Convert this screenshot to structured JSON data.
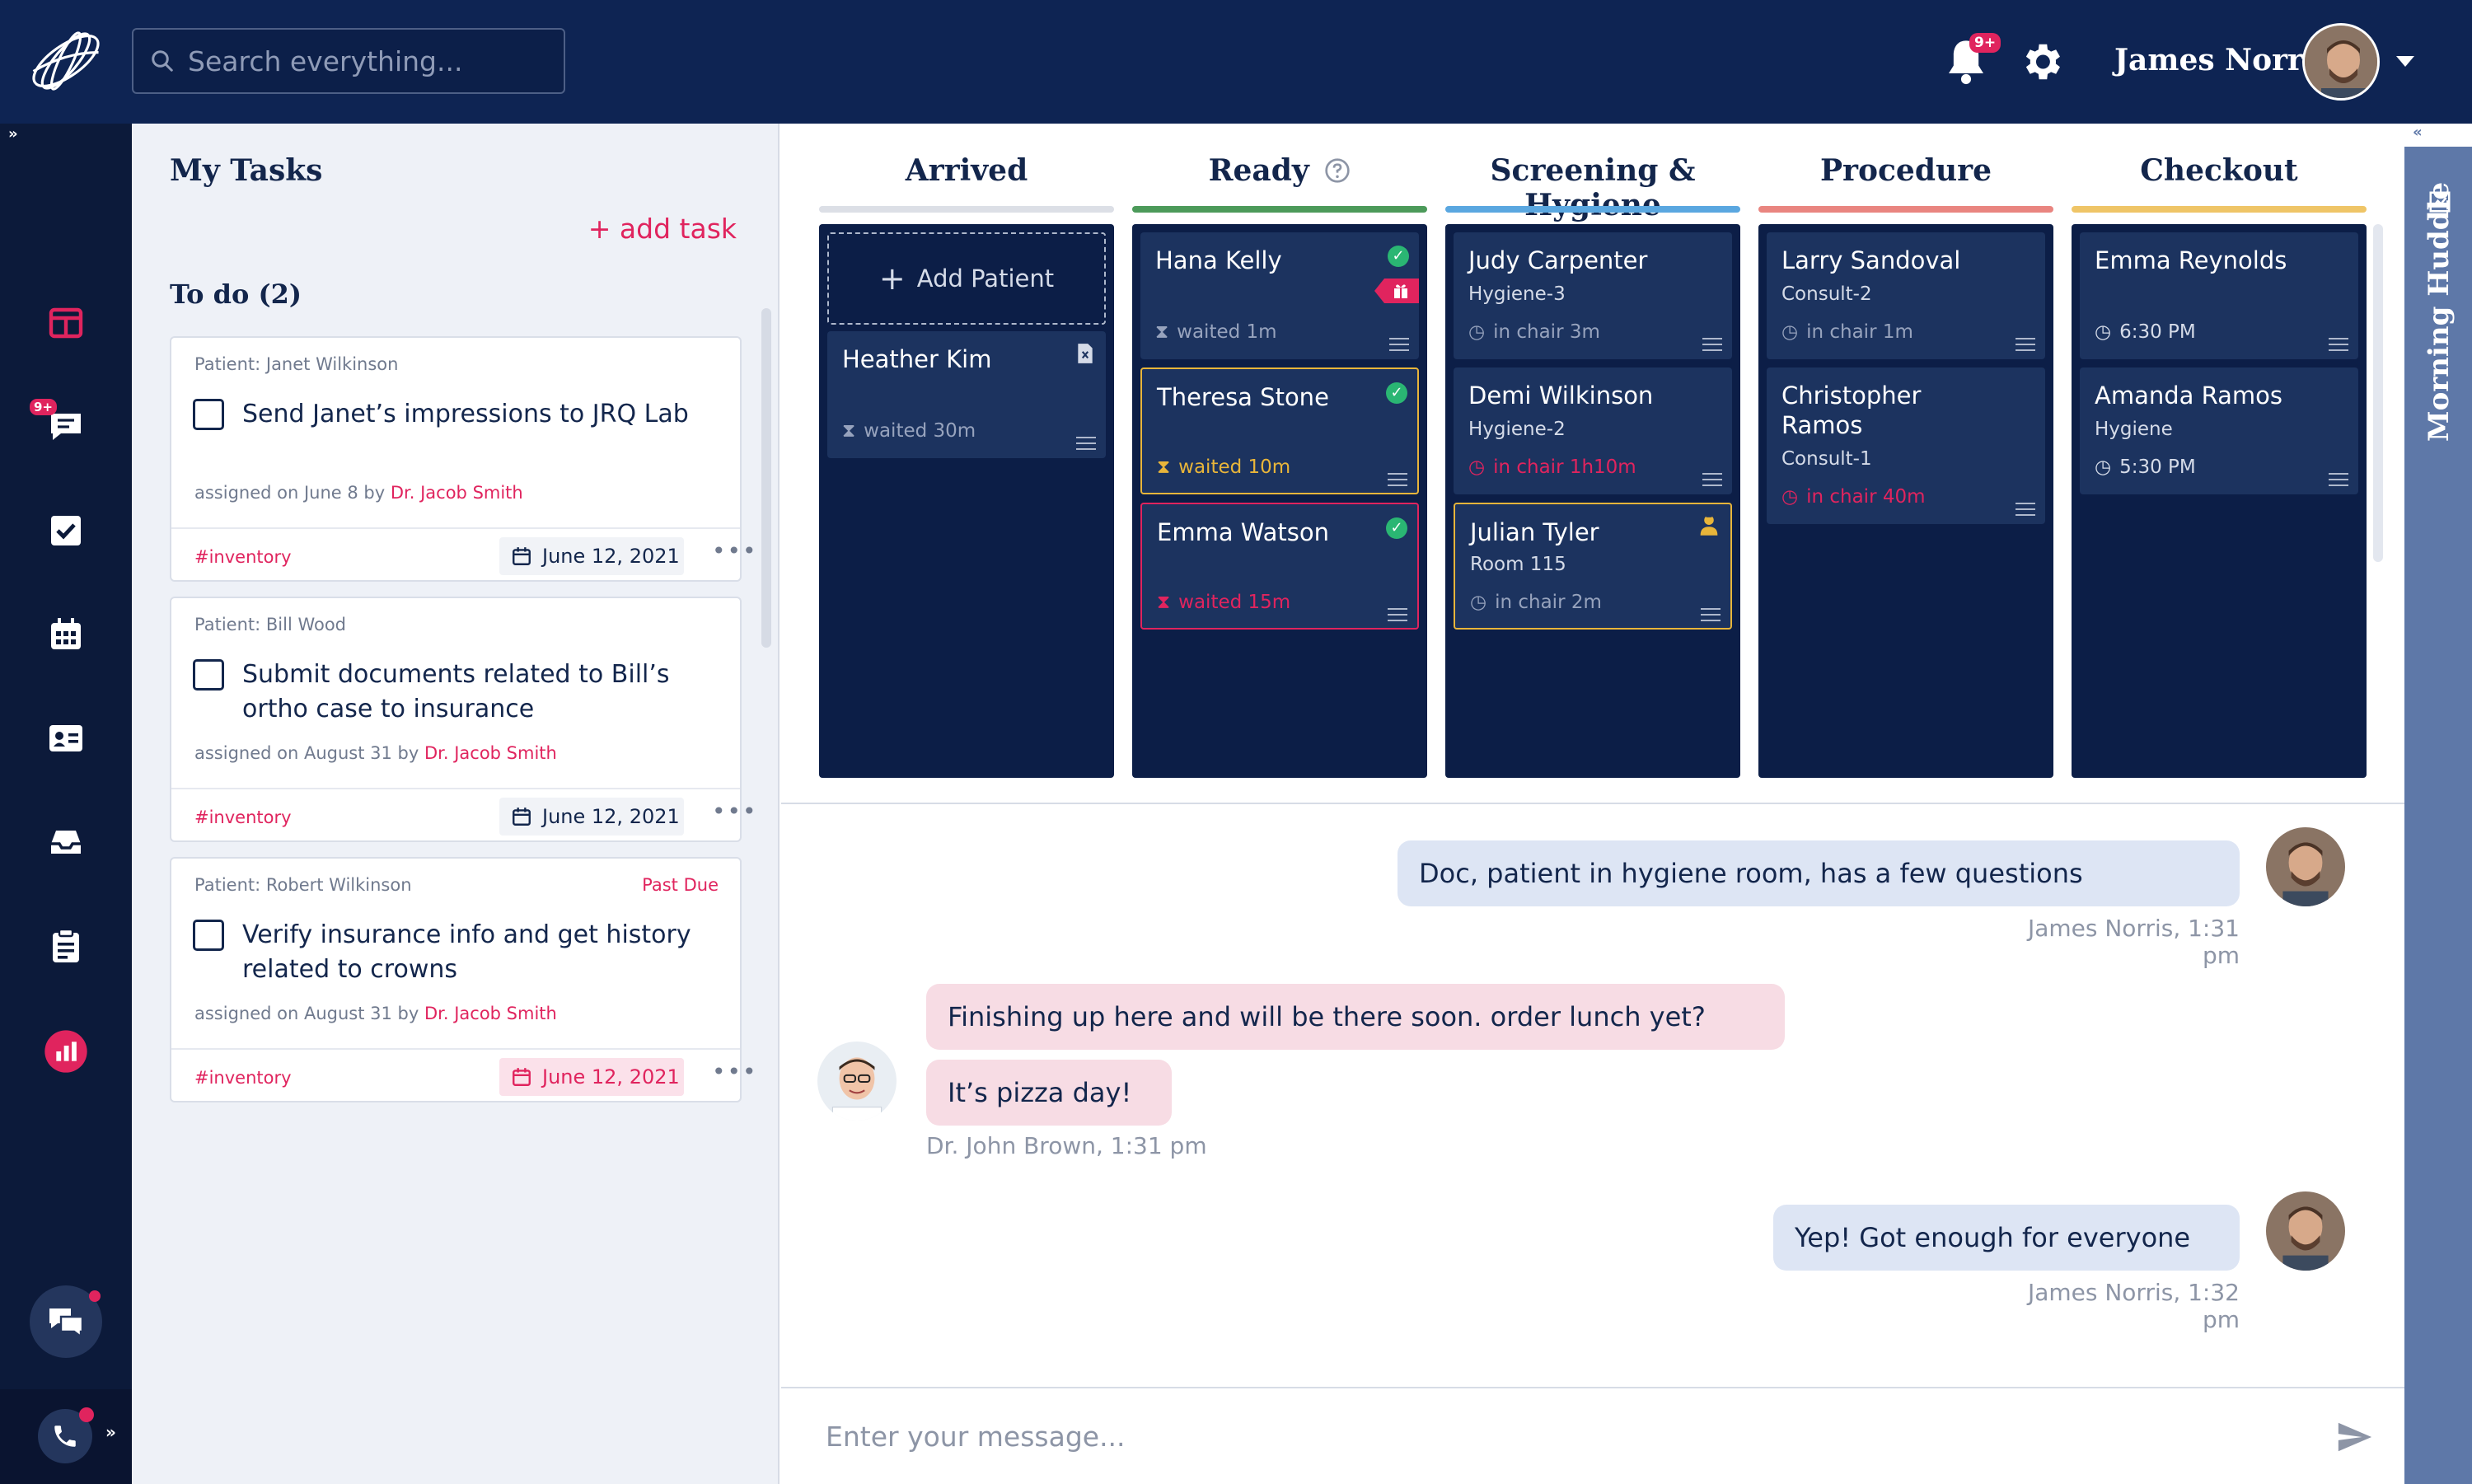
{
  "header": {
    "search_placeholder": "Search everything...",
    "notification_badge": "9+",
    "user_name": "James Norris"
  },
  "leftnav": {
    "messages_badge": "9+",
    "expand": "»"
  },
  "tasks": {
    "title": "My Tasks",
    "add_task": "+ add task",
    "todo_label": "To do (2)",
    "items": [
      {
        "patient": "Patient: Janet Wilkinson",
        "title": "Send Janet’s impressions to JRQ Lab",
        "assigned_prefix": "assigned on June 8 by ",
        "doctor": "Dr. Jacob Smith",
        "tag": "#inventory",
        "date": "June 12, 2021",
        "past_due": ""
      },
      {
        "patient": "Patient: Bill Wood",
        "title": "Submit documents related to Bill’s ortho case to insurance",
        "assigned_prefix": "assigned on August 31 by ",
        "doctor": "Dr. Jacob Smith",
        "tag": "#inventory",
        "date": "June 12, 2021",
        "past_due": ""
      },
      {
        "patient": "Patient: Robert Wilkinson",
        "title": "Verify insurance info and get history related to crowns",
        "assigned_prefix": "assigned on August 31 by ",
        "doctor": "Dr. Jacob Smith",
        "tag": "#inventory",
        "date": "June 12, 2021",
        "past_due": "Past Due"
      }
    ]
  },
  "board": {
    "columns": [
      {
        "title": "Arrived",
        "color": "#dcdfe6"
      },
      {
        "title": "Ready",
        "color": "#4c9a5a"
      },
      {
        "title": "Screening & Hygiene",
        "color": "#5aa7e0"
      },
      {
        "title": "Procedure",
        "color": "#e98580"
      },
      {
        "title": "Checkout",
        "color": "#efc567"
      }
    ],
    "add_patient": "Add Patient",
    "arrived": [
      {
        "name": "Heather Kim",
        "status": "waited 30m"
      }
    ],
    "ready": [
      {
        "name": "Hana Kelly",
        "status": "waited 1m"
      },
      {
        "name": "Theresa Stone",
        "status": "waited 10m"
      },
      {
        "name": "Emma Watson",
        "status": "waited 15m"
      }
    ],
    "screening": [
      {
        "name": "Judy Carpenter",
        "room": "Hygiene-3",
        "status": "in chair 3m"
      },
      {
        "name": "Demi Wilkinson",
        "room": "Hygiene-2",
        "status": "in chair 1h10m"
      },
      {
        "name": "Julian Tyler",
        "room": "Room 115",
        "status": "in chair 2m"
      }
    ],
    "procedure": [
      {
        "name": "Larry Sandoval",
        "room": "Consult-2",
        "status": "in chair 1m"
      },
      {
        "name": "Christopher Ramos",
        "room": "Consult-1",
        "status": "in chair 40m"
      }
    ],
    "checkout": [
      {
        "name": "Emma Reynolds",
        "room": "",
        "status": "6:30 PM"
      },
      {
        "name": "Amanda Ramos",
        "room": "Hygiene",
        "status": "5:30 PM"
      }
    ]
  },
  "chat": {
    "messages": [
      {
        "text": "Doc, patient in hygiene room, has a few questions",
        "meta": "James Norris, 1:31 pm"
      },
      {
        "text": "Finishing up here and will be there soon.  order lunch yet?"
      },
      {
        "text": "It’s pizza day!",
        "meta": "Dr. John Brown, 1:31 pm"
      },
      {
        "text": "Yep! Got enough for everyone",
        "meta": "James Norris, 1:32 pm"
      }
    ],
    "input_placeholder": "Enter your message..."
  },
  "rail": {
    "label": "Morning Huddle",
    "collapse": "«"
  }
}
